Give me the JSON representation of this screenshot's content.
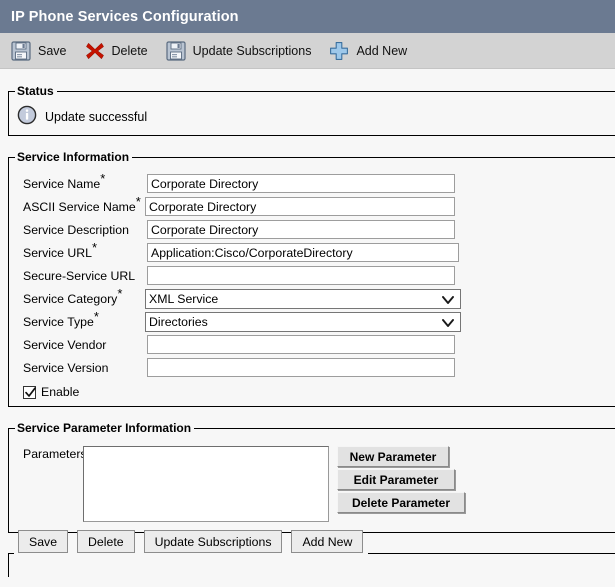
{
  "window": {
    "title": "IP Phone Services Configuration"
  },
  "toolbar": {
    "items": [
      {
        "label": "Save",
        "icon": "floppy-disk-icon"
      },
      {
        "label": "Delete",
        "icon": "red-x-icon"
      },
      {
        "label": "Update Subscriptions",
        "icon": "floppy-disk-icon"
      },
      {
        "label": "Add New",
        "icon": "plus-icon"
      }
    ]
  },
  "status": {
    "legend": "Status",
    "icon": "info-icon",
    "message": "Update successful"
  },
  "service_information": {
    "legend": "Service Information",
    "fields": [
      {
        "label": "Service Name",
        "required": true,
        "type": "text",
        "value": "Corporate Directory"
      },
      {
        "label": "ASCII Service Name",
        "required": true,
        "type": "text",
        "value": "Corporate Directory"
      },
      {
        "label": "Service Description",
        "required": false,
        "type": "text",
        "value": "Corporate Directory"
      },
      {
        "label": "Service URL",
        "required": true,
        "type": "text",
        "value": "Application:Cisco/CorporateDirectory"
      },
      {
        "label": "Secure-Service URL",
        "required": false,
        "type": "text",
        "value": ""
      },
      {
        "label": "Service Category",
        "required": true,
        "type": "select",
        "value": "XML Service",
        "options": [
          "XML Service"
        ]
      },
      {
        "label": "Service Type",
        "required": true,
        "type": "select",
        "value": "Directories",
        "options": [
          "Directories"
        ]
      },
      {
        "label": "Service Vendor",
        "required": false,
        "type": "text",
        "value": ""
      },
      {
        "label": "Service Version",
        "required": false,
        "type": "text",
        "value": ""
      }
    ],
    "enable_checkbox": {
      "label": "Enable",
      "checked": true
    }
  },
  "service_parameter_information": {
    "legend": "Service Parameter Information",
    "parameters_label": "Parameters",
    "parameters_list": [],
    "buttons": [
      {
        "label": "New Parameter"
      },
      {
        "label": "Edit Parameter"
      },
      {
        "label": "Delete Parameter"
      }
    ]
  },
  "bottom_buttons": [
    {
      "label": "Save"
    },
    {
      "label": "Delete"
    },
    {
      "label": "Update Subscriptions"
    },
    {
      "label": "Add New"
    }
  ],
  "colors": {
    "titlebar_bg": "#6b7a91",
    "toolbar_bg": "#d3d3d3",
    "page_bg": "#f7f7f7",
    "delete_icon": "#cc0000",
    "add_icon": "#7fb0e0"
  }
}
